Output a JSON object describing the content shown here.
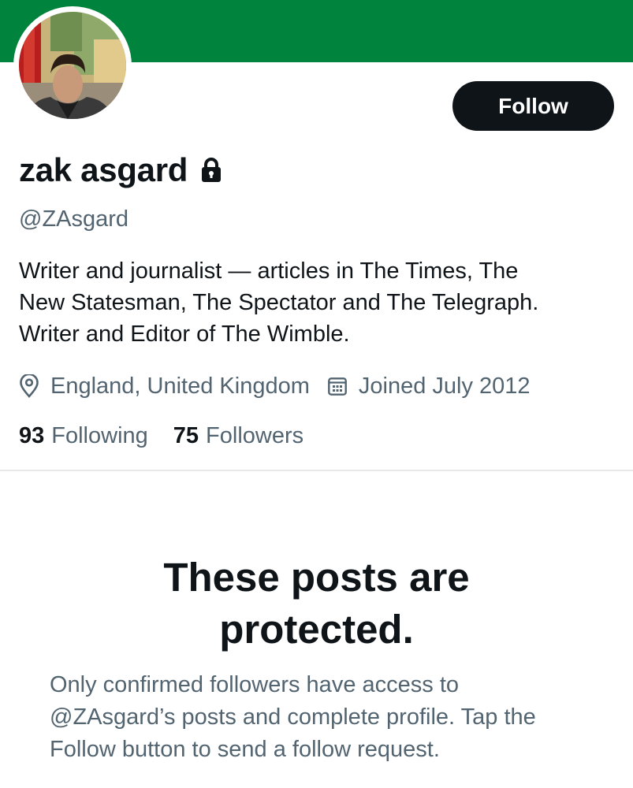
{
  "colors": {
    "banner": "#00843d",
    "button_bg": "#0f1419",
    "button_text": "#ffffff",
    "primary_text": "#0f1419",
    "secondary_text": "#536471",
    "divider": "#e7e9ea"
  },
  "profile": {
    "display_name": "zak asgard",
    "handle": "@ZAsgard",
    "protected_icon": "lock-icon",
    "bio_lines": [
      "Writer and journalist — articles in The Times, The",
      "New Statesman, The Spectator and The Telegraph.",
      "Writer and Editor of The Wimble."
    ],
    "location_icon": "location-pin-icon",
    "location": "England, United Kingdom",
    "joined_icon": "calendar-icon",
    "joined": "Joined July 2012",
    "following_count": "93",
    "following_label": "Following",
    "followers_count": "75",
    "followers_label": "Followers"
  },
  "actions": {
    "follow_label": "Follow"
  },
  "protected_notice": {
    "title_lines": [
      "These posts are",
      "protected."
    ],
    "body_lines": [
      "Only confirmed followers have access to",
      "@ZAsgard’s posts and complete profile. Tap the",
      "Follow button to send a follow request."
    ]
  }
}
